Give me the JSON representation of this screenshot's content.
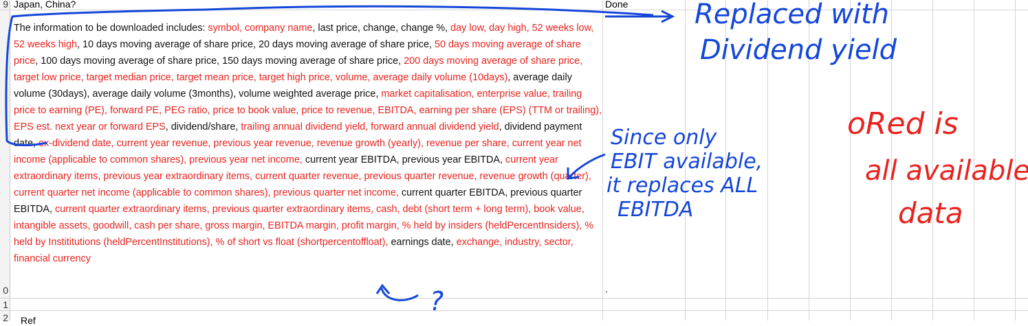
{
  "sheet": {
    "row_numbers": [
      "9",
      "0",
      "1",
      "2"
    ],
    "top_row_col_a": "Japan, China?",
    "top_row_col_b": "Done",
    "row10_col_b": ".",
    "bottom_partial_text": "Ref"
  },
  "main_cell": {
    "segments": [
      {
        "text": "The information to be downloaded includes: ",
        "color": "black"
      },
      {
        "text": "symbol, company name",
        "color": "red"
      },
      {
        "text": ", last price, change, change %, ",
        "color": "black"
      },
      {
        "text": "day low, day high, 52 weeks low, 52 weeks high",
        "color": "red"
      },
      {
        "text": ", 10 days moving average of share price, 20 days moving average of share price, ",
        "color": "black"
      },
      {
        "text": "50 days moving average of share price",
        "color": "red"
      },
      {
        "text": ", 100 days moving average of share price, 150 days moving average of share price, ",
        "color": "black"
      },
      {
        "text": "200 days moving average of share price, target low price, target median price, target mean price, target high price, volume, average daily volume (10days)",
        "color": "red"
      },
      {
        "text": ", average daily volume (30days), average daily volume (3months), volume weighted average price, ",
        "color": "black"
      },
      {
        "text": "market capitalisation, enterprise value, trailing price to earning (PE), forward PE, PEG ratio, price to book value, price to revenue, EBITDA, earning per share (EPS) (TTM or trailing), EPS est. next year or forward EPS",
        "color": "red"
      },
      {
        "text": ", dividend/share, ",
        "color": "black"
      },
      {
        "text": "trailing annual dividend yield, forward annual dividend yield",
        "color": "red"
      },
      {
        "text": ", dividend payment date, ",
        "color": "black"
      },
      {
        "text": "ex-dividend date, current year revenue, previous year revenue, revenue growth (yearly), revenue per share, current year net income (applicable to common shares), previous year net income, ",
        "color": "red"
      },
      {
        "text": "current year EBITDA, previous year EBITDA, ",
        "color": "black"
      },
      {
        "text": "current year extraordinary items, previous year extraordinary items, current quarter revenue, previous quarter revenue, revenue growth (quarter), current quarter net income (applicable to common shares), previous quarter net income, ",
        "color": "red"
      },
      {
        "text": "current quarter EBITDA, previous quarter EBITDA, ",
        "color": "black"
      },
      {
        "text": "current quarter extraordinary items, previous quarter extraordinary items, cash, debt (short term + long term), book value, intangible assets, goodwill, cash per share, gross margin, EBITDA margin, profit margin,  % held by insiders (heldPercentInsiders), % held by Instititutions (heldPercentInstitutions), % of short vs float (shortpercentoffloat), ",
        "color": "red"
      },
      {
        "text": "earnings date, ",
        "color": "black"
      },
      {
        "text": "exchange, industry, sector, financial currency",
        "color": "red"
      }
    ]
  },
  "annotations": {
    "replaced_line1": "Replaced with",
    "replaced_line2": "Dividend yield",
    "ebit_line1": "Since only",
    "ebit_line2": "EBIT available,",
    "ebit_line3": "it replaces ALL",
    "ebit_line4": "EBITDA",
    "red_line1": "oRed is",
    "red_line2": "all available",
    "red_line3": "data",
    "question": "?",
    "colors": {
      "blue": "#1446d8",
      "red": "#e8231f",
      "cell_red": "#e8231f"
    }
  }
}
